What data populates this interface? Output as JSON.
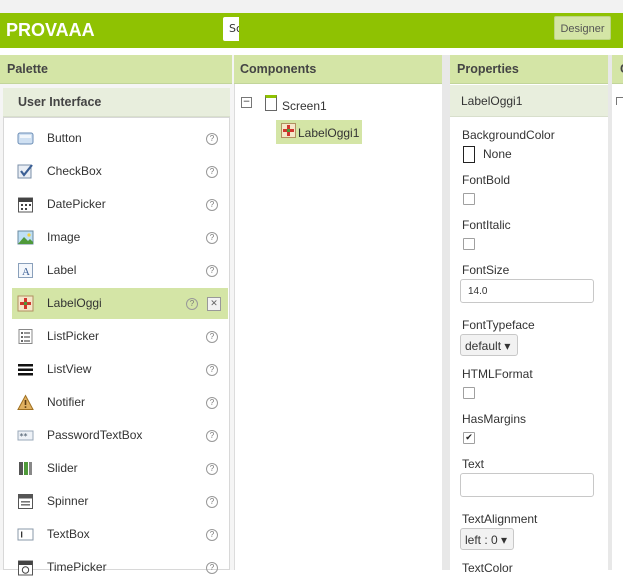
{
  "app": {
    "title": "PROVAAA",
    "screen_select": "Sc",
    "designer_label": "Designer"
  },
  "palette": {
    "header": "Palette",
    "category": "User Interface",
    "help_glyph": "?",
    "delete_glyph": "✕",
    "items": [
      {
        "label": "Button",
        "icon": "button-icon"
      },
      {
        "label": "CheckBox",
        "icon": "checkbox-icon"
      },
      {
        "label": "DatePicker",
        "icon": "calendar-icon"
      },
      {
        "label": "Image",
        "icon": "image-icon"
      },
      {
        "label": "Label",
        "icon": "label-icon"
      },
      {
        "label": "LabelOggi",
        "icon": "extension-icon"
      },
      {
        "label": "ListPicker",
        "icon": "listpicker-icon"
      },
      {
        "label": "ListView",
        "icon": "listview-icon"
      },
      {
        "label": "Notifier",
        "icon": "warning-icon"
      },
      {
        "label": "PasswordTextBox",
        "icon": "password-icon"
      },
      {
        "label": "Slider",
        "icon": "slider-icon"
      },
      {
        "label": "Spinner",
        "icon": "spinner-icon"
      },
      {
        "label": "TextBox",
        "icon": "textbox-icon"
      },
      {
        "label": "TimePicker",
        "icon": "clock-icon"
      }
    ]
  },
  "components": {
    "header": "Components",
    "toggle_glyph": "−",
    "root": "Screen1",
    "child": "LabelOggi1"
  },
  "properties": {
    "header": "Properties",
    "component_name": "LabelOggi1",
    "background_color_label": "BackgroundColor",
    "background_color_value": "None",
    "font_bold_label": "FontBold",
    "font_italic_label": "FontItalic",
    "font_size_label": "FontSize",
    "font_size_value": "14.0",
    "font_typeface_label": "FontTypeface",
    "font_typeface_value": "default ▾",
    "html_format_label": "HTMLFormat",
    "has_margins_label": "HasMargins",
    "has_margins_mark": "✔",
    "text_label": "Text",
    "text_value": "",
    "text_alignment_label": "TextAlignment",
    "text_alignment_value": "left : 0 ▾",
    "text_color_label": "TextColor"
  },
  "fourth_panel": {
    "header": "C"
  },
  "colors": {
    "accent": "#8fc202",
    "header_bg": "#d4e5a6",
    "selected_bg": "#d4e5a6"
  }
}
